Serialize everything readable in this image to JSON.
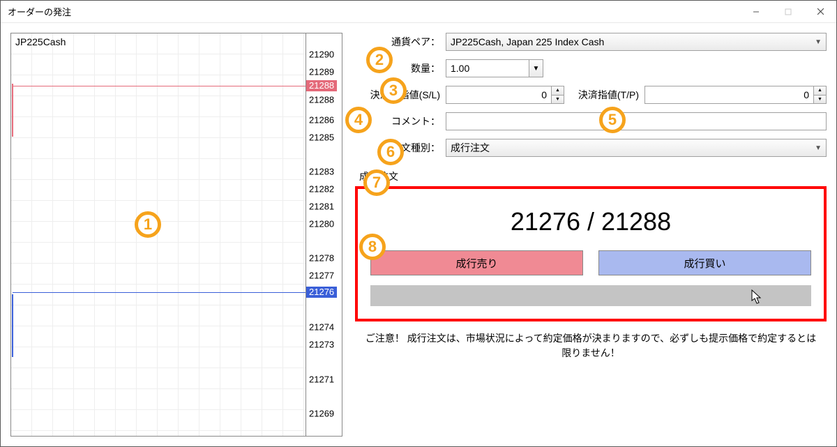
{
  "window": {
    "title": "オーダーの発注"
  },
  "chart": {
    "symbol": "JP225Cash",
    "ask": "21288",
    "bid": "21276",
    "ticks": [
      "21290",
      "21289",
      "21288",
      "21286",
      "21285",
      "21283",
      "21282",
      "21281",
      "21280",
      "21278",
      "21277",
      "21276",
      "21274",
      "21273",
      "21271",
      "21269"
    ]
  },
  "form": {
    "pair_label": "通貨ペア：",
    "pair_value": "JP225Cash, Japan 225 Index Cash",
    "qty_label": "数量：",
    "qty_value": "1.00",
    "sl_label": "決済逆指値(S/L)",
    "sl_value": "0",
    "tp_label": "決済指値(T/P)",
    "tp_value": "0",
    "comment_label": "コメント：",
    "ordertype_label": "注文種別：",
    "ordertype_value": "成行注文",
    "group_label": "成行注文"
  },
  "order": {
    "price_text": "21276 / 21288",
    "sell_label": "成行売り",
    "buy_label": "成行買い"
  },
  "notice": "ご注意！ 成行注文は、市場状況によって約定価格が決まりますので、必ずしも提示価格で約定するとは限りません！",
  "annotations": [
    "1",
    "2",
    "3",
    "4",
    "5",
    "6",
    "7",
    "8"
  ]
}
